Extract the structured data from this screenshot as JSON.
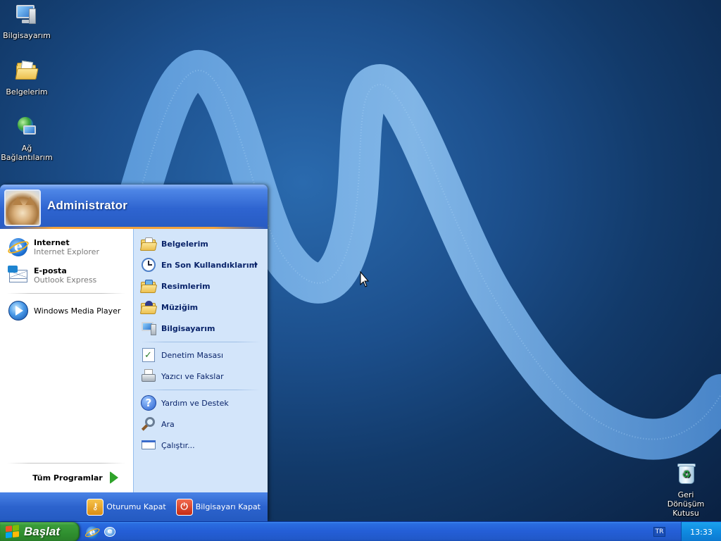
{
  "desktop": {
    "icons": [
      {
        "label": "Bilgisayarım",
        "icon": "my-computer-icon"
      },
      {
        "label": "Belgelerim",
        "icon": "my-documents-icon"
      },
      {
        "label": "Ağ Bağlantılarım",
        "label_line1": "Ağ",
        "label_line2": "Bağlantılarım",
        "icon": "network-connections-icon"
      },
      {
        "label": "Geri Dönüşüm Kutusu",
        "label_line1": "Geri Dönüşüm",
        "label_line2": "Kutusu",
        "icon": "recycle-bin-icon"
      }
    ],
    "wallpaper_colors": {
      "background": "#123a6a",
      "wave": "#7fb4e6"
    }
  },
  "start_menu": {
    "user": {
      "name": "Administrator",
      "avatar": "cat-avatar"
    },
    "pinned": [
      {
        "title": "Internet",
        "subtitle": "Internet Explorer",
        "icon": "internet-explorer-icon"
      },
      {
        "title": "E-posta",
        "subtitle": "Outlook Express",
        "icon": "outlook-express-icon"
      }
    ],
    "recent": [
      {
        "title": "Windows Media Player",
        "icon": "windows-media-player-icon"
      }
    ],
    "all_programs": "Tüm Programlar",
    "places": [
      {
        "label": "Belgelerim",
        "icon": "my-documents-icon",
        "bold": true
      },
      {
        "label": "En Son Kullandıklarım",
        "icon": "recent-documents-icon",
        "bold": true,
        "submenu": true
      },
      {
        "label": "Resimlerim",
        "icon": "my-pictures-icon",
        "bold": true
      },
      {
        "label": "Müziğim",
        "icon": "my-music-icon",
        "bold": true
      },
      {
        "label": "Bilgisayarım",
        "icon": "my-computer-icon",
        "bold": true
      }
    ],
    "system": [
      {
        "label": "Denetim Masası",
        "icon": "control-panel-icon"
      },
      {
        "label": "Yazıcı ve Fakslar",
        "icon": "printers-faxes-icon"
      }
    ],
    "help": [
      {
        "label": "Yardım ve Destek",
        "icon": "help-icon"
      },
      {
        "label": "Ara",
        "icon": "search-icon"
      },
      {
        "label": "Çalıştır...",
        "icon": "run-icon"
      }
    ],
    "footer": {
      "logoff": "Oturumu Kapat",
      "shutdown": "Bilgisayarı Kapat"
    },
    "colors": {
      "header": "#2e64d0",
      "accent": "#f3a33d",
      "right_pane": "#d3e5fa",
      "right_text": "#0a246a"
    }
  },
  "taskbar": {
    "start_label": "Başlat",
    "quick_launch": [
      "internet-explorer-icon",
      "outlook-express-icon"
    ],
    "language": "TR",
    "clock": "13:33",
    "colors": {
      "bar": "#245ed6",
      "start": "#2f8f2f",
      "tray": "#0f8ae0"
    }
  }
}
